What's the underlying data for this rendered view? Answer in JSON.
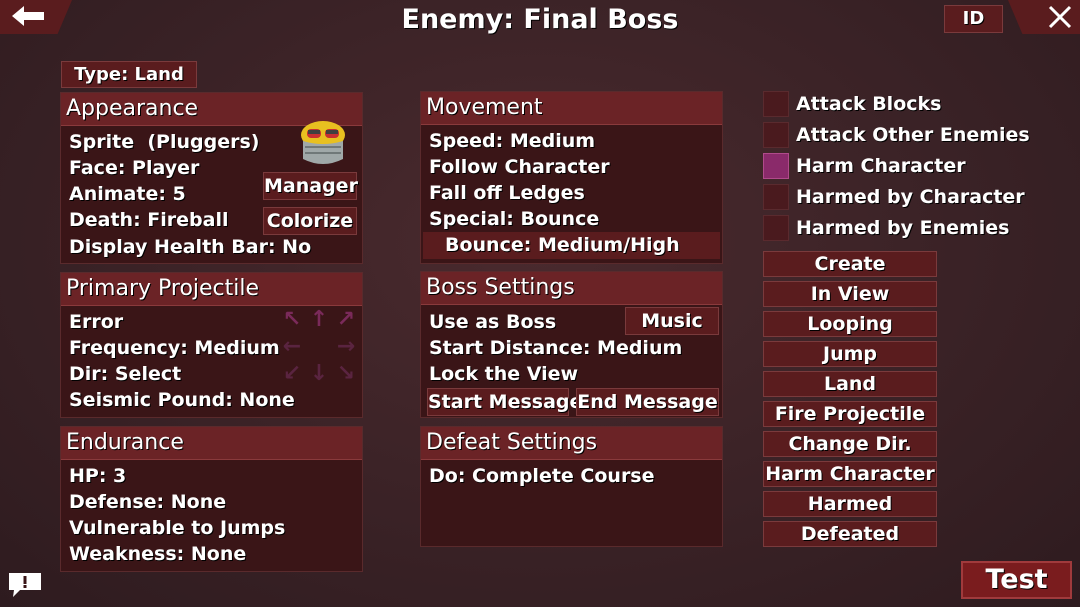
{
  "header": {
    "title": "Enemy: Final Boss",
    "id_label": "ID"
  },
  "type_label": "Type: Land",
  "appearance": {
    "title": "Appearance",
    "rows": [
      "Sprite  (Pluggers)",
      "Face: Player",
      "Animate: 5",
      "Death: Fireball",
      "Display Health Bar: No"
    ],
    "manager_label": "Manager",
    "colorize_label": "Colorize"
  },
  "primary_projectile": {
    "title": "Primary Projectile",
    "rows": [
      "Error",
      "Frequency: Medium",
      "Dir: Select",
      "Seismic Pound: None"
    ]
  },
  "endurance": {
    "title": "Endurance",
    "rows": [
      "HP: 3",
      "Defense: None",
      "Vulnerable to Jumps",
      "Weakness: None"
    ]
  },
  "movement": {
    "title": "Movement",
    "rows": [
      "Speed: Medium",
      "Follow Character",
      "Fall off Ledges",
      "Special: Bounce"
    ],
    "sub_row": "Bounce: Medium/High"
  },
  "boss_settings": {
    "title": "Boss Settings",
    "rows": [
      "Use as Boss",
      "Start Distance: Medium",
      "Lock the View"
    ],
    "music_label": "Music",
    "start_message_label": "Start Message",
    "end_message_label": "End Message"
  },
  "defeat_settings": {
    "title": "Defeat Settings",
    "rows": [
      "Do: Complete Course"
    ]
  },
  "toggles": [
    {
      "label": "Attack Blocks",
      "checked": false
    },
    {
      "label": "Attack Other Enemies",
      "checked": false
    },
    {
      "label": "Harm Character",
      "checked": true
    },
    {
      "label": "Harmed by Character",
      "checked": false
    },
    {
      "label": "Harmed by Enemies",
      "checked": false
    }
  ],
  "event_buttons": [
    "Create",
    "In View",
    "Looping",
    "Jump",
    "Land",
    "Fire Projectile",
    "Change Dir.",
    "Harm Character",
    "Harmed",
    "Defeated"
  ],
  "test_label": "Test",
  "colors": {
    "panel_header": "#6b2326",
    "panel_body": "#3a1517",
    "checked": "#8a2a6a",
    "accent_arrow": "#7a2a5a"
  }
}
